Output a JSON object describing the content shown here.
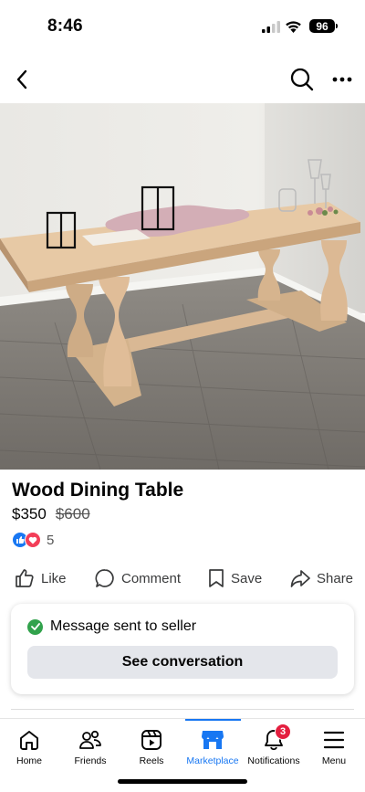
{
  "status_bar": {
    "time": "8:46",
    "battery": "96"
  },
  "header": {
    "back_icon": "chevron-left-icon",
    "search_icon": "search-icon",
    "more_icon": "more-horizontal-icon"
  },
  "listing": {
    "title": "Wood Dining Table",
    "price": "$350",
    "original_price": "$600",
    "reaction_count": "5"
  },
  "actions": [
    {
      "label": "Like",
      "icon": "thumbs-up-icon"
    },
    {
      "label": "Comment",
      "icon": "comment-icon"
    },
    {
      "label": "Save",
      "icon": "bookmark-icon"
    },
    {
      "label": "Share",
      "icon": "share-icon"
    }
  ],
  "message": {
    "status": "Message sent to seller",
    "button": "See conversation"
  },
  "tabs": [
    {
      "label": "Home",
      "icon": "home-icon",
      "active": false
    },
    {
      "label": "Friends",
      "icon": "friends-icon",
      "active": false
    },
    {
      "label": "Reels",
      "icon": "reels-icon",
      "active": false
    },
    {
      "label": "Marketplace",
      "icon": "marketplace-icon",
      "active": true
    },
    {
      "label": "Notifications",
      "icon": "bell-icon",
      "active": false,
      "badge": "3"
    },
    {
      "label": "Menu",
      "icon": "menu-icon",
      "active": false
    }
  ],
  "colors": {
    "accent": "#1877f2",
    "success": "#31a24c",
    "badge": "#e41e3f"
  }
}
